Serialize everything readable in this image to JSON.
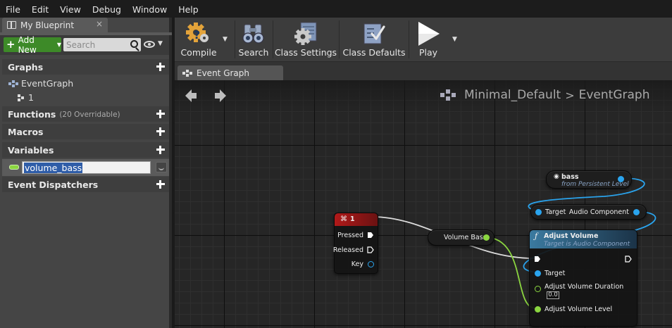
{
  "menu": [
    "File",
    "Edit",
    "View",
    "Debug",
    "Window",
    "Help"
  ],
  "left_panel": {
    "tab_title": "My Blueprint",
    "tab_close": "×",
    "add_new_label": "Add New",
    "search_placeholder": "Search",
    "sections": {
      "graphs": "Graphs",
      "functions": "Functions",
      "functions_count": "(20 Overridable)",
      "macros": "Macros",
      "variables": "Variables",
      "dispatchers": "Event Dispatchers"
    },
    "graph_items": [
      {
        "label": "EventGraph"
      },
      {
        "label": "1"
      }
    ],
    "variable_name": "volume_bass"
  },
  "toolbar": {
    "compile": "Compile",
    "search": "Search",
    "class_settings": "Class Settings",
    "class_defaults": "Class Defaults",
    "play": "Play"
  },
  "graph_tab": "Event Graph",
  "breadcrumb": {
    "blueprint": "Minimal_Default",
    "separator": ">",
    "graph": "EventGraph"
  },
  "nodes": {
    "key_event": {
      "title": "1",
      "pins": [
        "Pressed",
        "Released",
        "Key"
      ]
    },
    "get_var": {
      "label": "Volume Bass"
    },
    "bass_var": {
      "label": "bass",
      "sub": "from Persistent Level"
    },
    "audio_comp": {
      "in": "Target",
      "out": "Audio Component"
    },
    "adjust_volume": {
      "title": "Adjust Volume",
      "sub": "Target is Audio Component",
      "pins": [
        "Target",
        "Adjust Volume Duration",
        "Adjust Volume Level"
      ],
      "duration_value": "0.0"
    }
  },
  "colors": {
    "accent_green": "#3d8a28",
    "pin_blue": "#2aa4ee",
    "pin_green": "#8bd640",
    "key_header": "#9a1a1a",
    "function_header": "#2a5a7a"
  }
}
